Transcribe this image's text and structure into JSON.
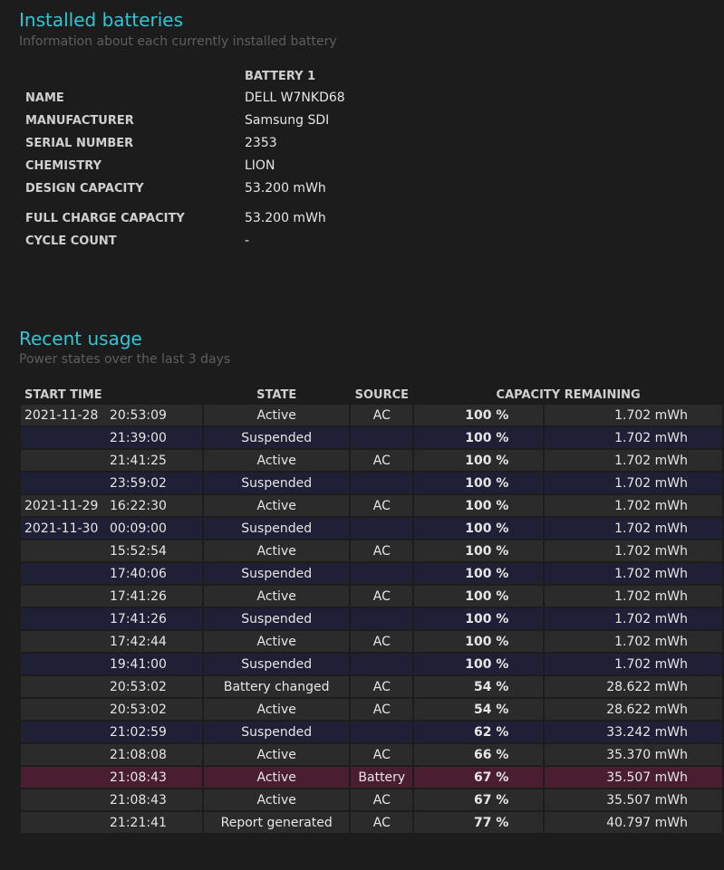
{
  "installed_batteries": {
    "title": "Installed batteries",
    "subtitle": "Information about each currently installed battery",
    "column_header": "BATTERY 1",
    "fields": [
      {
        "label": "NAME",
        "value": "DELL W7NKD68"
      },
      {
        "label": "MANUFACTURER",
        "value": "Samsung SDI"
      },
      {
        "label": "SERIAL NUMBER",
        "value": "2353"
      },
      {
        "label": "CHEMISTRY",
        "value": "LION"
      },
      {
        "label": "DESIGN CAPACITY",
        "value": "53.200 mWh"
      },
      {
        "label": "FULL CHARGE CAPACITY",
        "value": "53.200 mWh"
      },
      {
        "label": "CYCLE COUNT",
        "value": "-"
      }
    ]
  },
  "recent_usage": {
    "title": "Recent usage",
    "subtitle": "Power states over the last 3 days",
    "headers": {
      "start_time": "START TIME",
      "state": "STATE",
      "source": "SOURCE",
      "capacity": "CAPACITY REMAINING"
    },
    "rows": [
      {
        "date": "2021-11-28",
        "time": "20:53:09",
        "state": "Active",
        "source": "AC",
        "pct": "100 %",
        "mwh": "1.702 mWh",
        "kind": "active"
      },
      {
        "date": "",
        "time": "21:39:00",
        "state": "Suspended",
        "source": "",
        "pct": "100 %",
        "mwh": "1.702 mWh",
        "kind": "suspended"
      },
      {
        "date": "",
        "time": "21:41:25",
        "state": "Active",
        "source": "AC",
        "pct": "100 %",
        "mwh": "1.702 mWh",
        "kind": "active"
      },
      {
        "date": "",
        "time": "23:59:02",
        "state": "Suspended",
        "source": "",
        "pct": "100 %",
        "mwh": "1.702 mWh",
        "kind": "suspended"
      },
      {
        "date": "2021-11-29",
        "time": "16:22:30",
        "state": "Active",
        "source": "AC",
        "pct": "100 %",
        "mwh": "1.702 mWh",
        "kind": "active"
      },
      {
        "date": "2021-11-30",
        "time": "00:09:00",
        "state": "Suspended",
        "source": "",
        "pct": "100 %",
        "mwh": "1.702 mWh",
        "kind": "suspended"
      },
      {
        "date": "",
        "time": "15:52:54",
        "state": "Active",
        "source": "AC",
        "pct": "100 %",
        "mwh": "1.702 mWh",
        "kind": "active"
      },
      {
        "date": "",
        "time": "17:40:06",
        "state": "Suspended",
        "source": "",
        "pct": "100 %",
        "mwh": "1.702 mWh",
        "kind": "suspended"
      },
      {
        "date": "",
        "time": "17:41:26",
        "state": "Active",
        "source": "AC",
        "pct": "100 %",
        "mwh": "1.702 mWh",
        "kind": "active"
      },
      {
        "date": "",
        "time": "17:41:26",
        "state": "Suspended",
        "source": "",
        "pct": "100 %",
        "mwh": "1.702 mWh",
        "kind": "suspended"
      },
      {
        "date": "",
        "time": "17:42:44",
        "state": "Active",
        "source": "AC",
        "pct": "100 %",
        "mwh": "1.702 mWh",
        "kind": "active"
      },
      {
        "date": "",
        "time": "19:41:00",
        "state": "Suspended",
        "source": "",
        "pct": "100 %",
        "mwh": "1.702 mWh",
        "kind": "suspended"
      },
      {
        "date": "",
        "time": "20:53:02",
        "state": "Battery changed",
        "source": "AC",
        "pct": "54 %",
        "mwh": "28.622 mWh",
        "kind": "changed"
      },
      {
        "date": "",
        "time": "20:53:02",
        "state": "Active",
        "source": "AC",
        "pct": "54 %",
        "mwh": "28.622 mWh",
        "kind": "active"
      },
      {
        "date": "",
        "time": "21:02:59",
        "state": "Suspended",
        "source": "",
        "pct": "62 %",
        "mwh": "33.242 mWh",
        "kind": "suspended"
      },
      {
        "date": "",
        "time": "21:08:08",
        "state": "Active",
        "source": "AC",
        "pct": "66 %",
        "mwh": "35.370 mWh",
        "kind": "active"
      },
      {
        "date": "",
        "time": "21:08:43",
        "state": "Active",
        "source": "Battery",
        "pct": "67 %",
        "mwh": "35.507 mWh",
        "kind": "battery"
      },
      {
        "date": "",
        "time": "21:08:43",
        "state": "Active",
        "source": "AC",
        "pct": "67 %",
        "mwh": "35.507 mWh",
        "kind": "active"
      },
      {
        "date": "",
        "time": "21:21:41",
        "state": "Report generated",
        "source": "AC",
        "pct": "77 %",
        "mwh": "40.797 mWh",
        "kind": "report"
      }
    ]
  },
  "colors": {
    "heading": "#2ec7d3",
    "background": "#1c1c1c",
    "row_active": "#2b2b2b",
    "row_suspended": "#1f1f36",
    "row_battery": "#4a1d30"
  }
}
